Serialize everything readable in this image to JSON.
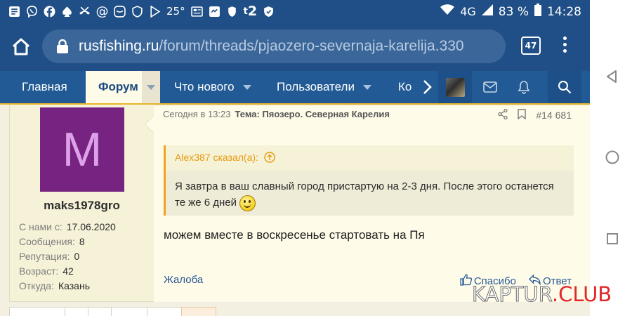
{
  "status_bar": {
    "left_icons": [
      "notification-icon",
      "viber-icon",
      "facebook-icon",
      "spade-app-icon",
      "missed-call-icon",
      "at-sign-icon",
      "mail-app-icon",
      "shield-icon",
      "play-store-icon",
      "temperature-icon",
      "news-icon",
      "message-icon",
      "vpn-shield-icon",
      "tele2-icon",
      "shield-check-icon"
    ],
    "temperature": "25°",
    "network": "4G",
    "battery": "83 %",
    "time": "14:28"
  },
  "browser": {
    "url_domain": "rusfishing.ru",
    "url_path": "/forum/threads/pjaozero-severnaja-karelija.330",
    "tab_count": "47"
  },
  "nav": {
    "items": [
      {
        "label": "Главная"
      },
      {
        "label": "Форум"
      },
      {
        "label": "Что нового"
      },
      {
        "label": "Пользователи"
      },
      {
        "label": "Ко"
      }
    ]
  },
  "user": {
    "avatar_letter": "M",
    "username": "maks1978gro",
    "stats": [
      {
        "label": "С нами с:",
        "value": "17.06.2020"
      },
      {
        "label": "Сообщения:",
        "value": "8"
      },
      {
        "label": "Репутация:",
        "value": "0"
      },
      {
        "label": "Возраст:",
        "value": "42"
      },
      {
        "label": "Откуда:",
        "value": "Казань"
      }
    ]
  },
  "post": {
    "time": "Сегодня в 13:23",
    "thread_title": "Тема: Пяозеро. Северная Карелия",
    "post_number": "#14 681",
    "quote_author": "Alex387 сказал(а):",
    "quote_text": "Я завтра в ваш славный город пристартую на 2-3 дня. После этого останется те же 6 дней",
    "message": "можем вместе в воскресенье стартовать на Пя",
    "report_label": "Жалоба",
    "like_label": "Спасибо",
    "reply_label": "Ответ"
  },
  "watermark": {
    "kaptur": "KAPTUR",
    "club": ".CLUB"
  },
  "colors": {
    "header_blue": "#1f4f86",
    "nav_blue": "#215a94",
    "accent_orange": "#f2a120",
    "avatar_purple": "#762381",
    "link_blue": "#2a5a97"
  }
}
